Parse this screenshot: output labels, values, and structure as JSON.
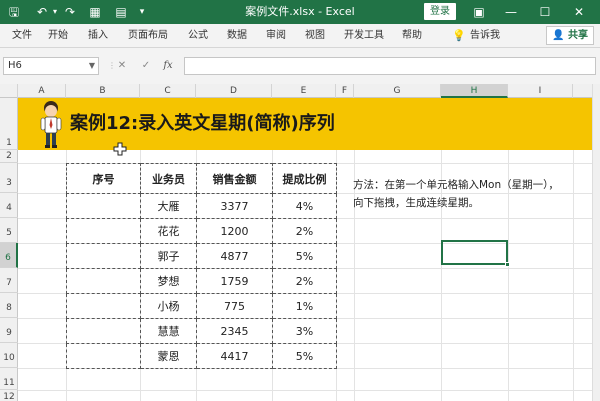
{
  "app": {
    "doc_title": "案例文件.xlsx  -  Excel",
    "login_label": "登录",
    "share_label": "共享",
    "share_icon": "person-add-icon"
  },
  "ribbon": {
    "tabs": [
      "文件",
      "开始",
      "插入",
      "页面布局",
      "公式",
      "数据",
      "审阅",
      "视图",
      "开发工具",
      "帮助"
    ],
    "tellme": "告诉我"
  },
  "formula_bar": {
    "name_box": "H6",
    "cancel_symbol": "✕",
    "enter_symbol": "✓",
    "fx_symbol": "fx",
    "value": ""
  },
  "grid": {
    "columns": [
      "A",
      "B",
      "C",
      "D",
      "E",
      "F",
      "G",
      "H",
      "I"
    ],
    "rows": [
      "1",
      "2",
      "3",
      "4",
      "5",
      "6",
      "7",
      "8",
      "9",
      "10",
      "11",
      "12"
    ],
    "active_column": "H",
    "active_row": "6"
  },
  "banner": {
    "title": "案例12:录入英文星期(简称)序列",
    "color": "#f5c400"
  },
  "table": {
    "headers": [
      "序号",
      "业务员",
      "销售金额",
      "提成比例"
    ],
    "rows": [
      [
        "",
        "大雁",
        "3377",
        "4%"
      ],
      [
        "",
        "花花",
        "1200",
        "2%"
      ],
      [
        "",
        "郭子",
        "4877",
        "5%"
      ],
      [
        "",
        "梦想",
        "1759",
        "2%"
      ],
      [
        "",
        "小杨",
        "775",
        "1%"
      ],
      [
        "",
        "慧慧",
        "2345",
        "3%"
      ],
      [
        "",
        "蒙恩",
        "4417",
        "5%"
      ]
    ]
  },
  "note": {
    "text": "方法：在第一个单元格输入Mon（星期一），向下拖拽，生成连续星期。"
  },
  "colors": {
    "excel_green": "#217346"
  }
}
